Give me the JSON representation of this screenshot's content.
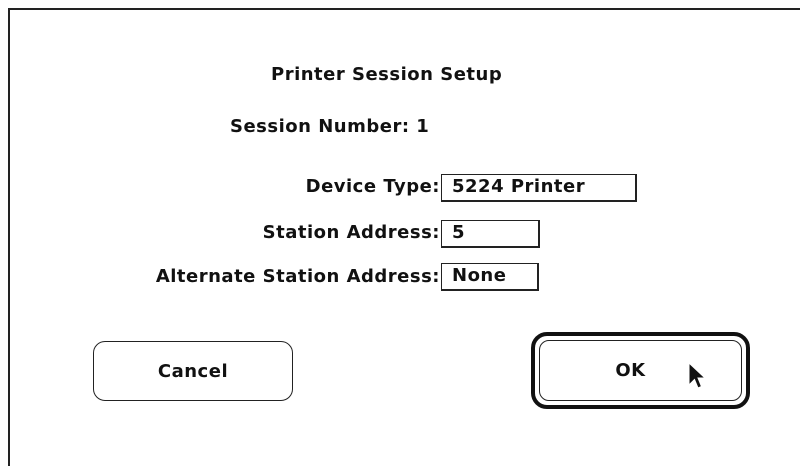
{
  "dialog": {
    "title": "Printer Session Setup",
    "session_label": "Session Number: 1"
  },
  "fields": {
    "device_type": {
      "label": "Device Type:",
      "value": "5224 Printer"
    },
    "station_address": {
      "label": "Station Address:",
      "value": "5"
    },
    "alternate_station_address": {
      "label": "Alternate Station Address:",
      "value": "None"
    }
  },
  "buttons": {
    "cancel_label": "Cancel",
    "ok_label": "OK"
  },
  "icons": {
    "cursor": "arrow-cursor-icon"
  }
}
